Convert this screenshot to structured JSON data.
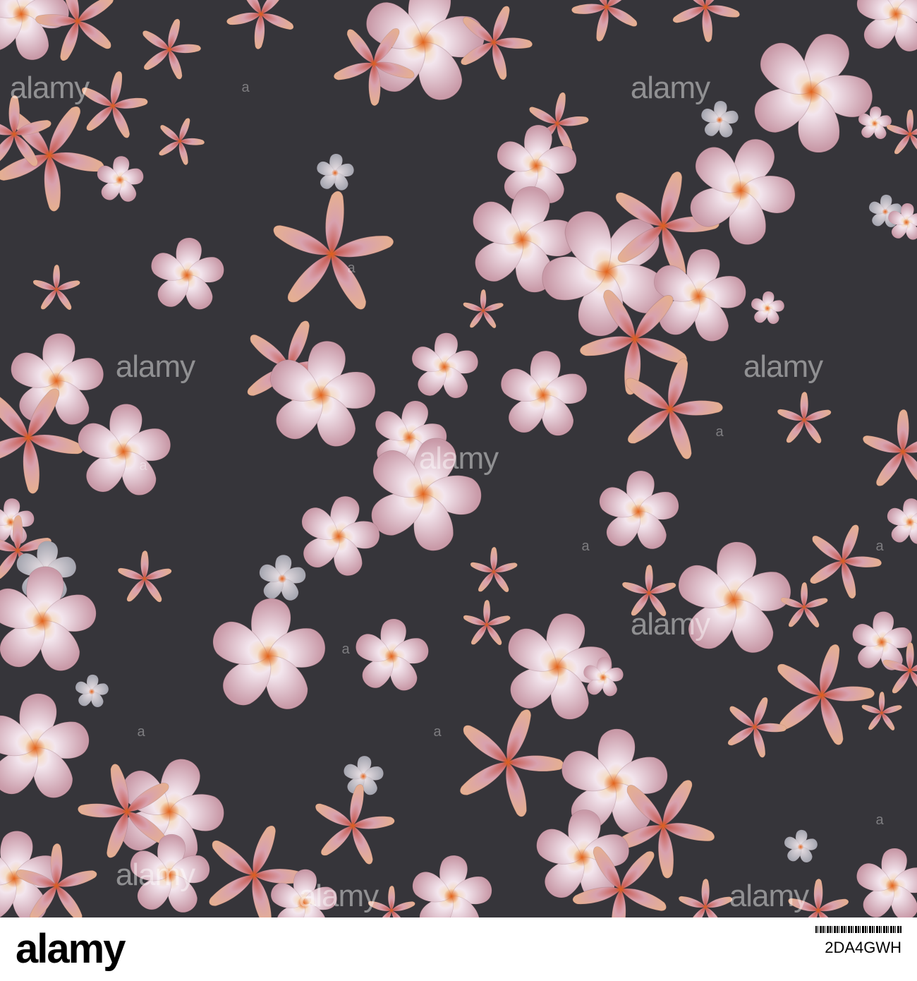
{
  "pattern": {
    "background": "#36353a",
    "petal_light": "#f1e3ec",
    "petal_mid": "#d9a8b4",
    "petal_deep": "#c98677",
    "petal_peach": "#e8b08e",
    "center": "#e06a1f",
    "grey_light": "#dadbe0",
    "grey_mid": "#a9aab3"
  },
  "watermark": {
    "text": "alamy",
    "small": "a"
  },
  "footer": {
    "logo_text": "alamy",
    "image_id": "2DA4GWH"
  }
}
